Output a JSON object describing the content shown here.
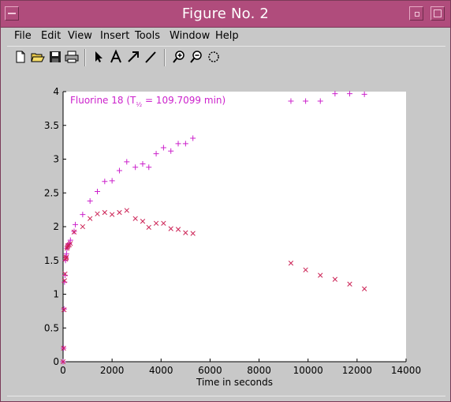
{
  "window": {
    "title": "Figure No. 2"
  },
  "menubar": {
    "items": [
      {
        "label": "File",
        "name": "menu-file"
      },
      {
        "label": "Edit",
        "name": "menu-edit"
      },
      {
        "label": "View",
        "name": "menu-view"
      },
      {
        "label": "Insert",
        "name": "menu-insert"
      },
      {
        "label": "Tools",
        "name": "menu-tools"
      },
      {
        "label": "Window",
        "name": "menu-window"
      },
      {
        "label": "Help",
        "name": "menu-help"
      }
    ]
  },
  "toolbar": {
    "buttons": [
      "new-file-icon",
      "open-folder-icon",
      "save-icon",
      "print-icon",
      "select-arrow-icon",
      "insert-text-icon",
      "insert-arrow-icon",
      "insert-line-icon",
      "zoom-in-icon",
      "zoom-out-icon",
      "rotate-icon"
    ]
  },
  "colors": {
    "titlebar": "#b04c7c",
    "series_plus": "#cc22cc",
    "series_x": "#cc2255"
  },
  "chart_data": {
    "type": "scatter",
    "title": "",
    "xlabel": "Time in seconds",
    "ylabel": "",
    "xlim": [
      0,
      14000
    ],
    "ylim": [
      0,
      4
    ],
    "xticks": [
      "0",
      "2000",
      "4000",
      "6000",
      "8000",
      "10000",
      "12000",
      "14000"
    ],
    "yticks": [
      "0",
      "0.5",
      "1",
      "1.5",
      "2",
      "2.5",
      "3",
      "3.5",
      "4"
    ],
    "legend": {
      "text_main": "Fluorine 18 (T",
      "text_sub": "½",
      "text_tail": " = 109.7099 min)",
      "placement": "top-left"
    },
    "grid": false,
    "series": [
      {
        "marker": "plus",
        "color": "#cc22cc",
        "points": [
          [
            0,
            0
          ],
          [
            20,
            0.2
          ],
          [
            40,
            0.78
          ],
          [
            60,
            1.18
          ],
          [
            80,
            1.28
          ],
          [
            100,
            1.5
          ],
          [
            120,
            1.55
          ],
          [
            140,
            1.6
          ],
          [
            160,
            1.68
          ],
          [
            180,
            1.7
          ],
          [
            200,
            1.73
          ],
          [
            250,
            1.75
          ],
          [
            300,
            1.8
          ],
          [
            450,
            1.93
          ],
          [
            500,
            2.03
          ],
          [
            800,
            2.18
          ],
          [
            1100,
            2.38
          ],
          [
            1400,
            2.52
          ],
          [
            1700,
            2.67
          ],
          [
            2000,
            2.68
          ],
          [
            2300,
            2.83
          ],
          [
            2600,
            2.96
          ],
          [
            2950,
            2.88
          ],
          [
            3250,
            2.93
          ],
          [
            3500,
            2.88
          ],
          [
            3800,
            3.08
          ],
          [
            4100,
            3.17
          ],
          [
            4400,
            3.12
          ],
          [
            4700,
            3.23
          ],
          [
            5000,
            3.23
          ],
          [
            5300,
            3.31
          ],
          [
            9300,
            3.86
          ],
          [
            9900,
            3.86
          ],
          [
            10500,
            3.86
          ],
          [
            11100,
            3.97
          ],
          [
            11700,
            3.97
          ],
          [
            12300,
            3.96
          ]
        ]
      },
      {
        "marker": "x",
        "color": "#cc2255",
        "points": [
          [
            0,
            0
          ],
          [
            20,
            0.2
          ],
          [
            40,
            0.77
          ],
          [
            60,
            1.2
          ],
          [
            80,
            1.3
          ],
          [
            100,
            1.52
          ],
          [
            120,
            1.54
          ],
          [
            140,
            1.55
          ],
          [
            160,
            1.68
          ],
          [
            180,
            1.7
          ],
          [
            200,
            1.72
          ],
          [
            250,
            1.73
          ],
          [
            300,
            1.75
          ],
          [
            450,
            1.92
          ],
          [
            800,
            2.0
          ],
          [
            1100,
            2.12
          ],
          [
            1400,
            2.19
          ],
          [
            1700,
            2.21
          ],
          [
            2000,
            2.18
          ],
          [
            2300,
            2.21
          ],
          [
            2600,
            2.24
          ],
          [
            2950,
            2.12
          ],
          [
            3250,
            2.08
          ],
          [
            3500,
            1.99
          ],
          [
            3800,
            2.05
          ],
          [
            4100,
            2.05
          ],
          [
            4400,
            1.97
          ],
          [
            4700,
            1.96
          ],
          [
            5000,
            1.91
          ],
          [
            5300,
            1.9
          ],
          [
            9300,
            1.46
          ],
          [
            9900,
            1.36
          ],
          [
            10500,
            1.28
          ],
          [
            11100,
            1.22
          ],
          [
            11700,
            1.15
          ],
          [
            12300,
            1.08
          ]
        ]
      }
    ]
  }
}
